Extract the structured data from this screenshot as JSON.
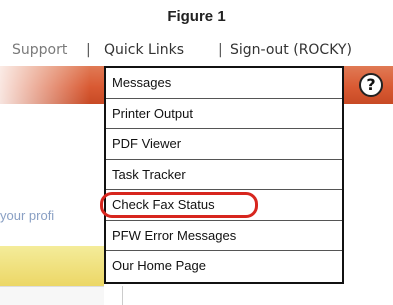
{
  "figure_caption": "Figure 1",
  "topnav": {
    "support": "Support",
    "separator": "|",
    "quick_links": "Quick Links",
    "sign_out": "Sign-out (ROCKY)"
  },
  "help_icon": "?",
  "profile_snippet": "your profi",
  "menu": {
    "items": [
      {
        "label": "Messages"
      },
      {
        "label": "Printer Output"
      },
      {
        "label": "PDF Viewer"
      },
      {
        "label": "Task Tracker"
      },
      {
        "label": "Check Fax Status",
        "highlighted": true
      },
      {
        "label": "PFW Error Messages"
      },
      {
        "label": "Our Home Page"
      }
    ]
  },
  "colors": {
    "header_band": "#d95a33",
    "highlight_ring": "#d7261e",
    "yellow_bar": "#ecd766"
  }
}
